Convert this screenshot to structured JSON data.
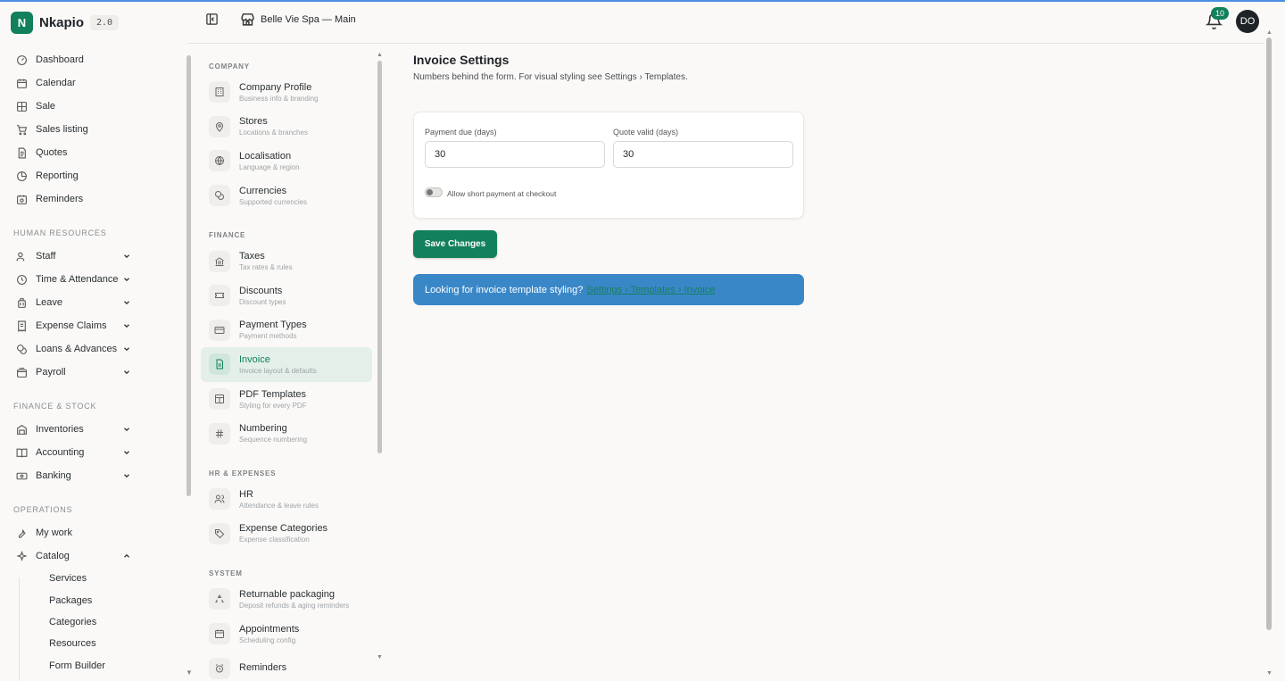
{
  "brand": {
    "logo_letter": "N",
    "name": "Nkapio",
    "version": "2.0",
    "accent": "#12805c"
  },
  "header": {
    "store": "Belle Vie Spa — Main",
    "notifications": "10",
    "avatar": "DO"
  },
  "sidebar": {
    "items": [
      {
        "label": "Dashboard",
        "icon": "gauge-icon"
      },
      {
        "label": "Calendar",
        "icon": "calendar-icon"
      },
      {
        "label": "Sale",
        "icon": "grid-icon"
      },
      {
        "label": "Sales listing",
        "icon": "cart-icon"
      },
      {
        "label": "Quotes",
        "icon": "document-icon"
      },
      {
        "label": "Reporting",
        "icon": "pie-chart-icon"
      },
      {
        "label": "Reminders",
        "icon": "calendar-clock-icon"
      }
    ],
    "sections": [
      {
        "label": "HUMAN RESOURCES",
        "items": [
          {
            "label": "Staff",
            "icon": "users-icon"
          },
          {
            "label": "Time & Attendance",
            "icon": "clock-icon"
          },
          {
            "label": "Leave",
            "icon": "luggage-icon"
          },
          {
            "label": "Expense Claims",
            "icon": "receipt-icon"
          },
          {
            "label": "Loans & Advances",
            "icon": "coins-icon"
          },
          {
            "label": "Payroll",
            "icon": "wallet-icon"
          }
        ]
      },
      {
        "label": "FINANCE & STOCK",
        "items": [
          {
            "label": "Inventories",
            "icon": "warehouse-icon"
          },
          {
            "label": "Accounting",
            "icon": "book-icon"
          },
          {
            "label": "Banking",
            "icon": "banknote-icon"
          }
        ]
      },
      {
        "label": "OPERATIONS",
        "items": [
          {
            "label": "My work",
            "icon": "wrench-icon"
          },
          {
            "label": "Catalog",
            "icon": "sparkles-icon"
          }
        ]
      }
    ],
    "catalog_children": [
      "Services",
      "Packages",
      "Categories",
      "Resources",
      "Form Builder"
    ]
  },
  "settings_nav": {
    "groups": [
      {
        "label": "COMPANY",
        "items": [
          {
            "title": "Company Profile",
            "subtitle": "Business info & branding",
            "icon": "building-icon"
          },
          {
            "title": "Stores",
            "subtitle": "Locations & branches",
            "icon": "map-pin-icon"
          },
          {
            "title": "Localisation",
            "subtitle": "Language & region",
            "icon": "globe-icon"
          },
          {
            "title": "Currencies",
            "subtitle": "Supported currencies",
            "icon": "coins-icon"
          }
        ]
      },
      {
        "label": "FINANCE",
        "items": [
          {
            "title": "Taxes",
            "subtitle": "Tax rates & rules",
            "icon": "landmark-icon"
          },
          {
            "title": "Discounts",
            "subtitle": "Discount types",
            "icon": "ticket-icon"
          },
          {
            "title": "Payment Types",
            "subtitle": "Payment methods",
            "icon": "credit-card-icon"
          },
          {
            "title": "Invoice",
            "subtitle": "Invoice layout & defaults",
            "icon": "file-text-icon",
            "active": true
          },
          {
            "title": "PDF Templates",
            "subtitle": "Styling for every PDF",
            "icon": "layout-icon"
          },
          {
            "title": "Numbering",
            "subtitle": "Sequence numbering",
            "icon": "hash-icon"
          }
        ]
      },
      {
        "label": "HR & EXPENSES",
        "items": [
          {
            "title": "HR",
            "subtitle": "Attendance & leave rules",
            "icon": "users-icon"
          },
          {
            "title": "Expense Categories",
            "subtitle": "Expense classification",
            "icon": "tag-icon"
          }
        ]
      },
      {
        "label": "SYSTEM",
        "items": [
          {
            "title": "Returnable packaging",
            "subtitle": "Deposit refunds & aging reminders",
            "icon": "recycle-icon"
          },
          {
            "title": "Appointments",
            "subtitle": "Scheduling config",
            "icon": "calendar-icon"
          },
          {
            "title": "Reminders",
            "subtitle": "",
            "icon": "alarm-icon"
          }
        ]
      }
    ]
  },
  "main": {
    "title": "Invoice Settings",
    "subtitle": "Numbers behind the form. For visual styling see Settings › Templates.",
    "payment_due_label": "Payment due (days)",
    "payment_due_value": "30",
    "quote_valid_label": "Quote valid (days)",
    "quote_valid_value": "30",
    "short_payment_label": "Allow short payment at checkout",
    "short_payment_enabled": false,
    "save_label": "Save Changes",
    "notice_text": "Looking for invoice template styling?",
    "notice_link": "Settings › Templates › Invoice"
  }
}
